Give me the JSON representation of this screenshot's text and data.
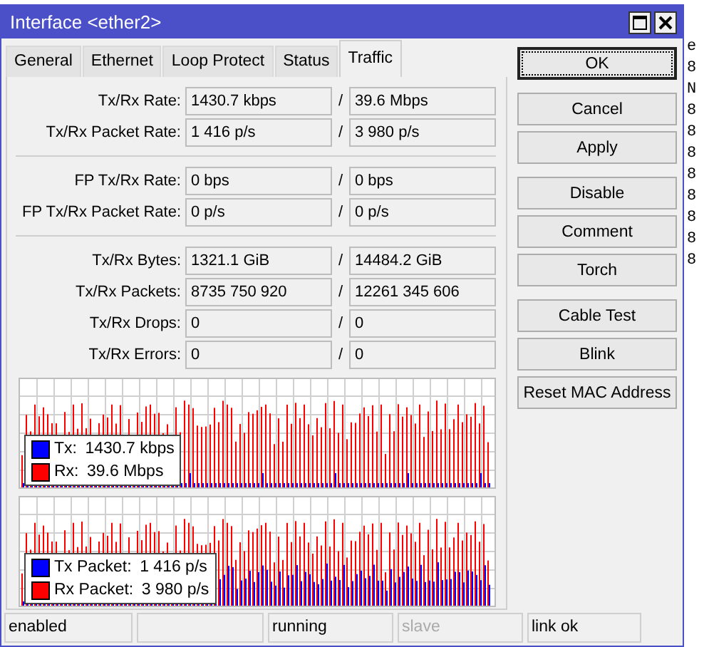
{
  "background_text": [
    "e",
    "8",
    "N",
    "8",
    "8",
    "8",
    "8",
    "8",
    "8",
    "8",
    "8"
  ],
  "window": {
    "title": "Interface <ether2>"
  },
  "tabs": [
    {
      "label": "General",
      "selected": false
    },
    {
      "label": "Ethernet",
      "selected": false
    },
    {
      "label": "Loop Protect",
      "selected": false
    },
    {
      "label": "Status",
      "selected": false
    },
    {
      "label": "Traffic",
      "selected": true
    }
  ],
  "field_groups": [
    [
      {
        "label": "Tx/Rx Rate:",
        "tx": "1430.7 kbps",
        "rx": "39.6 Mbps"
      },
      {
        "label": "Tx/Rx Packet Rate:",
        "tx": "1 416 p/s",
        "rx": "3 980 p/s"
      }
    ],
    [
      {
        "label": "FP Tx/Rx Rate:",
        "tx": "0 bps",
        "rx": "0 bps"
      },
      {
        "label": "FP Tx/Rx Packet Rate:",
        "tx": "0 p/s",
        "rx": "0 p/s"
      }
    ],
    [
      {
        "label": "Tx/Rx Bytes:",
        "tx": "1321.1 GiB",
        "rx": "14484.2 GiB"
      },
      {
        "label": "Tx/Rx Packets:",
        "tx": "8735 750 920",
        "rx": "12261 345 606"
      },
      {
        "label": "Tx/Rx Drops:",
        "tx": "0",
        "rx": "0"
      },
      {
        "label": "Tx/Rx Errors:",
        "tx": "0",
        "rx": "0"
      }
    ]
  ],
  "separator": "/",
  "graphs": [
    {
      "kind": "rate",
      "legend": [
        {
          "label": "Tx:",
          "value": "1430.7 kbps",
          "color": "#0000ff"
        },
        {
          "label": "Rx:",
          "value": "39.6 Mbps",
          "color": "#ff0000"
        }
      ]
    },
    {
      "kind": "packets",
      "legend": [
        {
          "label": "Tx Packet:",
          "value": "1 416 p/s",
          "color": "#0000ff"
        },
        {
          "label": "Rx Packet:",
          "value": "3 980 p/s",
          "color": "#ff0000"
        }
      ]
    }
  ],
  "buttons": [
    [
      {
        "label": "OK",
        "focused": true
      }
    ],
    [
      {
        "label": "Cancel",
        "focused": false
      },
      {
        "label": "Apply",
        "focused": false
      }
    ],
    [
      {
        "label": "Disable",
        "focused": false
      },
      {
        "label": "Comment",
        "focused": false
      },
      {
        "label": "Torch",
        "focused": false
      }
    ],
    [
      {
        "label": "Cable Test",
        "focused": false
      },
      {
        "label": "Blink",
        "focused": false
      },
      {
        "label": "Reset MAC Address",
        "focused": false
      }
    ]
  ],
  "status_bar": [
    {
      "kind": "text",
      "text": "enabled",
      "disabled": false
    },
    {
      "kind": "blank"
    },
    {
      "kind": "text",
      "text": "running",
      "disabled": false
    },
    {
      "kind": "text",
      "text": "slave",
      "disabled": true
    },
    {
      "kind": "text",
      "text": "link ok",
      "disabled": false
    }
  ]
}
